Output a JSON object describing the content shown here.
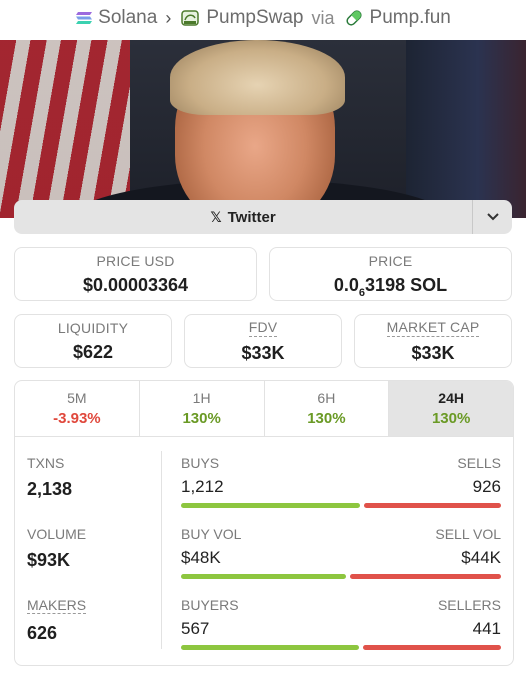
{
  "breadcrumb": {
    "chain": "Solana",
    "dex": "PumpSwap",
    "via": "via",
    "launchpad": "Pump.fun"
  },
  "social": {
    "twitter_label": "Twitter"
  },
  "price": {
    "usd_label": "PRICE USD",
    "usd_value": "$0.00003364",
    "native_label": "PRICE",
    "native_prefix": "0.0",
    "native_zeros": "6",
    "native_suffix": "3198 SOL"
  },
  "metrics": {
    "liquidity_label": "LIQUIDITY",
    "liquidity_value": "$622",
    "fdv_label": "FDV",
    "fdv_value": "$33K",
    "mcap_label": "MARKET CAP",
    "mcap_value": "$33K"
  },
  "timeframes": [
    {
      "label": "5M",
      "change": "-3.93%",
      "direction": "negative"
    },
    {
      "label": "1H",
      "change": "130%",
      "direction": "positive"
    },
    {
      "label": "6H",
      "change": "130%",
      "direction": "positive"
    },
    {
      "label": "24H",
      "change": "130%",
      "direction": "positive",
      "selected": true
    }
  ],
  "stats": {
    "txns_label": "TXNS",
    "txns_value": "2,138",
    "volume_label": "VOLUME",
    "volume_value": "$93K",
    "makers_label": "MAKERS",
    "makers_value": "626",
    "buys_label": "BUYS",
    "buys_value": "1,212",
    "sells_label": "SELLS",
    "sells_value": "926",
    "buys_fraction": 0.567,
    "buy_vol_label": "BUY VOL",
    "buy_vol_value": "$48K",
    "sell_vol_label": "SELL VOL",
    "sell_vol_value": "$44K",
    "buy_vol_fraction": 0.522,
    "buyers_label": "BUYERS",
    "buyers_value": "567",
    "sellers_label": "SELLERS",
    "sellers_value": "441",
    "buyers_fraction": 0.563
  },
  "colors": {
    "positive": "#6a9a25",
    "negative": "#e0483c",
    "buy_bar": "#8dc63f",
    "sell_bar": "#e0524a"
  }
}
